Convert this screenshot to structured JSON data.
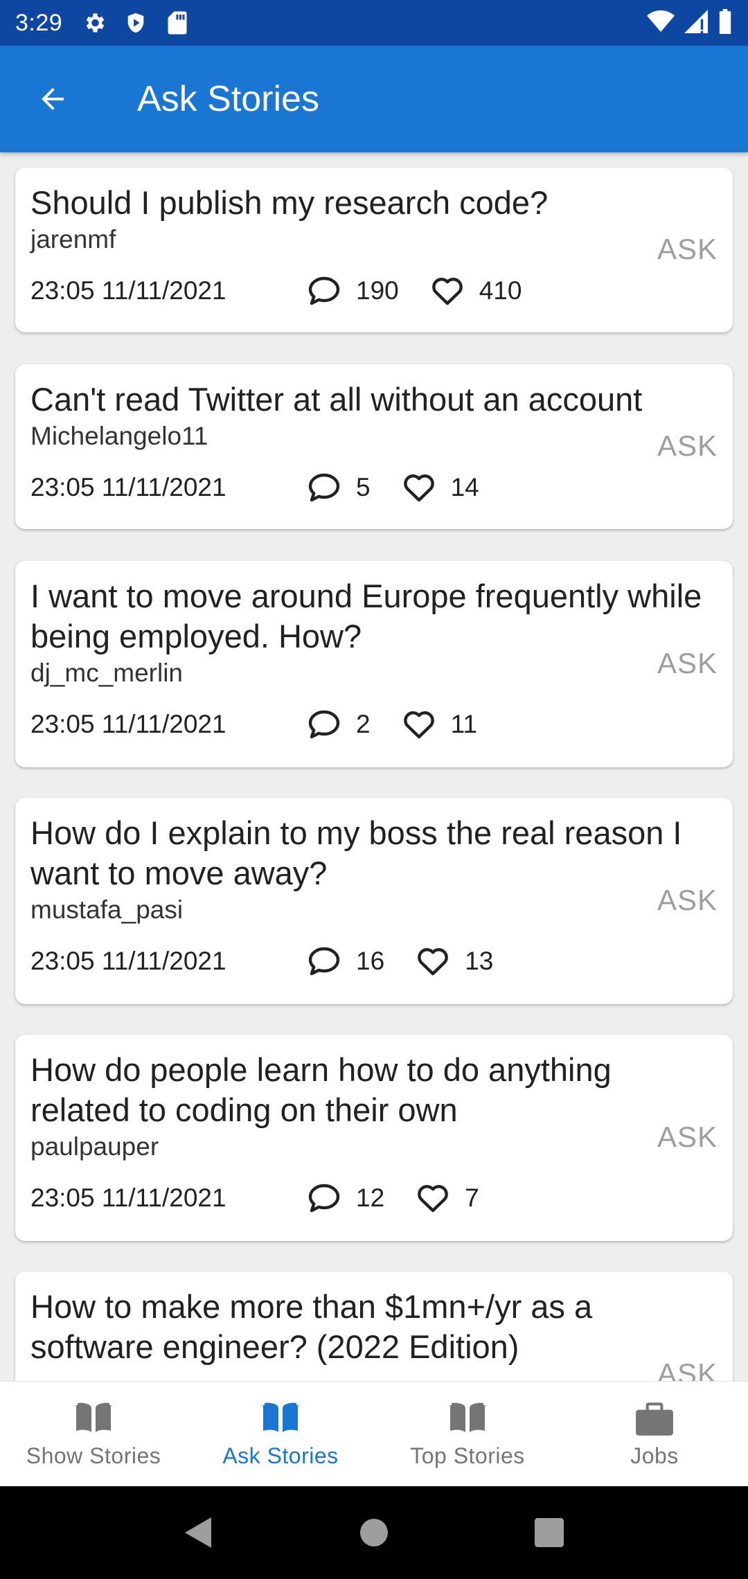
{
  "status_bar": {
    "time": "3:29"
  },
  "app_bar": {
    "title": "Ask Stories"
  },
  "stories": [
    {
      "title": "Should I publish my research code?",
      "user": "jarenmf",
      "time": "23:05 11/11/2021",
      "comments": "190",
      "likes": "410",
      "tag": "ASK"
    },
    {
      "title": "Can't read Twitter at all without an account",
      "user": "Michelangelo11",
      "time": "23:05 11/11/2021",
      "comments": "5",
      "likes": "14",
      "tag": "ASK"
    },
    {
      "title": "I want to move around Europe frequently while being employed. How?",
      "user": "dj_mc_merlin",
      "time": "23:05 11/11/2021",
      "comments": "2",
      "likes": "11",
      "tag": "ASK"
    },
    {
      "title": "How do I explain to my boss the real reason I want to move away?",
      "user": "mustafa_pasi",
      "time": "23:05 11/11/2021",
      "comments": "16",
      "likes": "13",
      "tag": "ASK"
    },
    {
      "title": "How do people learn how to do anything related to coding on their own",
      "user": "paulpauper",
      "time": "23:05 11/11/2021",
      "comments": "12",
      "likes": "7",
      "tag": "ASK"
    },
    {
      "title": "How to make more than $1mn+/yr as a software engineer? (2022 Edition)",
      "tag": "ASK"
    }
  ],
  "bottom_nav": {
    "items": [
      {
        "label": "Show Stories",
        "icon": "book-icon"
      },
      {
        "label": "Ask Stories",
        "icon": "book-icon",
        "active": true
      },
      {
        "label": "Top Stories",
        "icon": "book-icon"
      },
      {
        "label": "Jobs",
        "icon": "briefcase-icon"
      }
    ]
  },
  "colors": {
    "primary": "#1976D2",
    "primary_dark": "#0D47A1",
    "inactive": "#757575",
    "tag": "#9e9e9e"
  }
}
